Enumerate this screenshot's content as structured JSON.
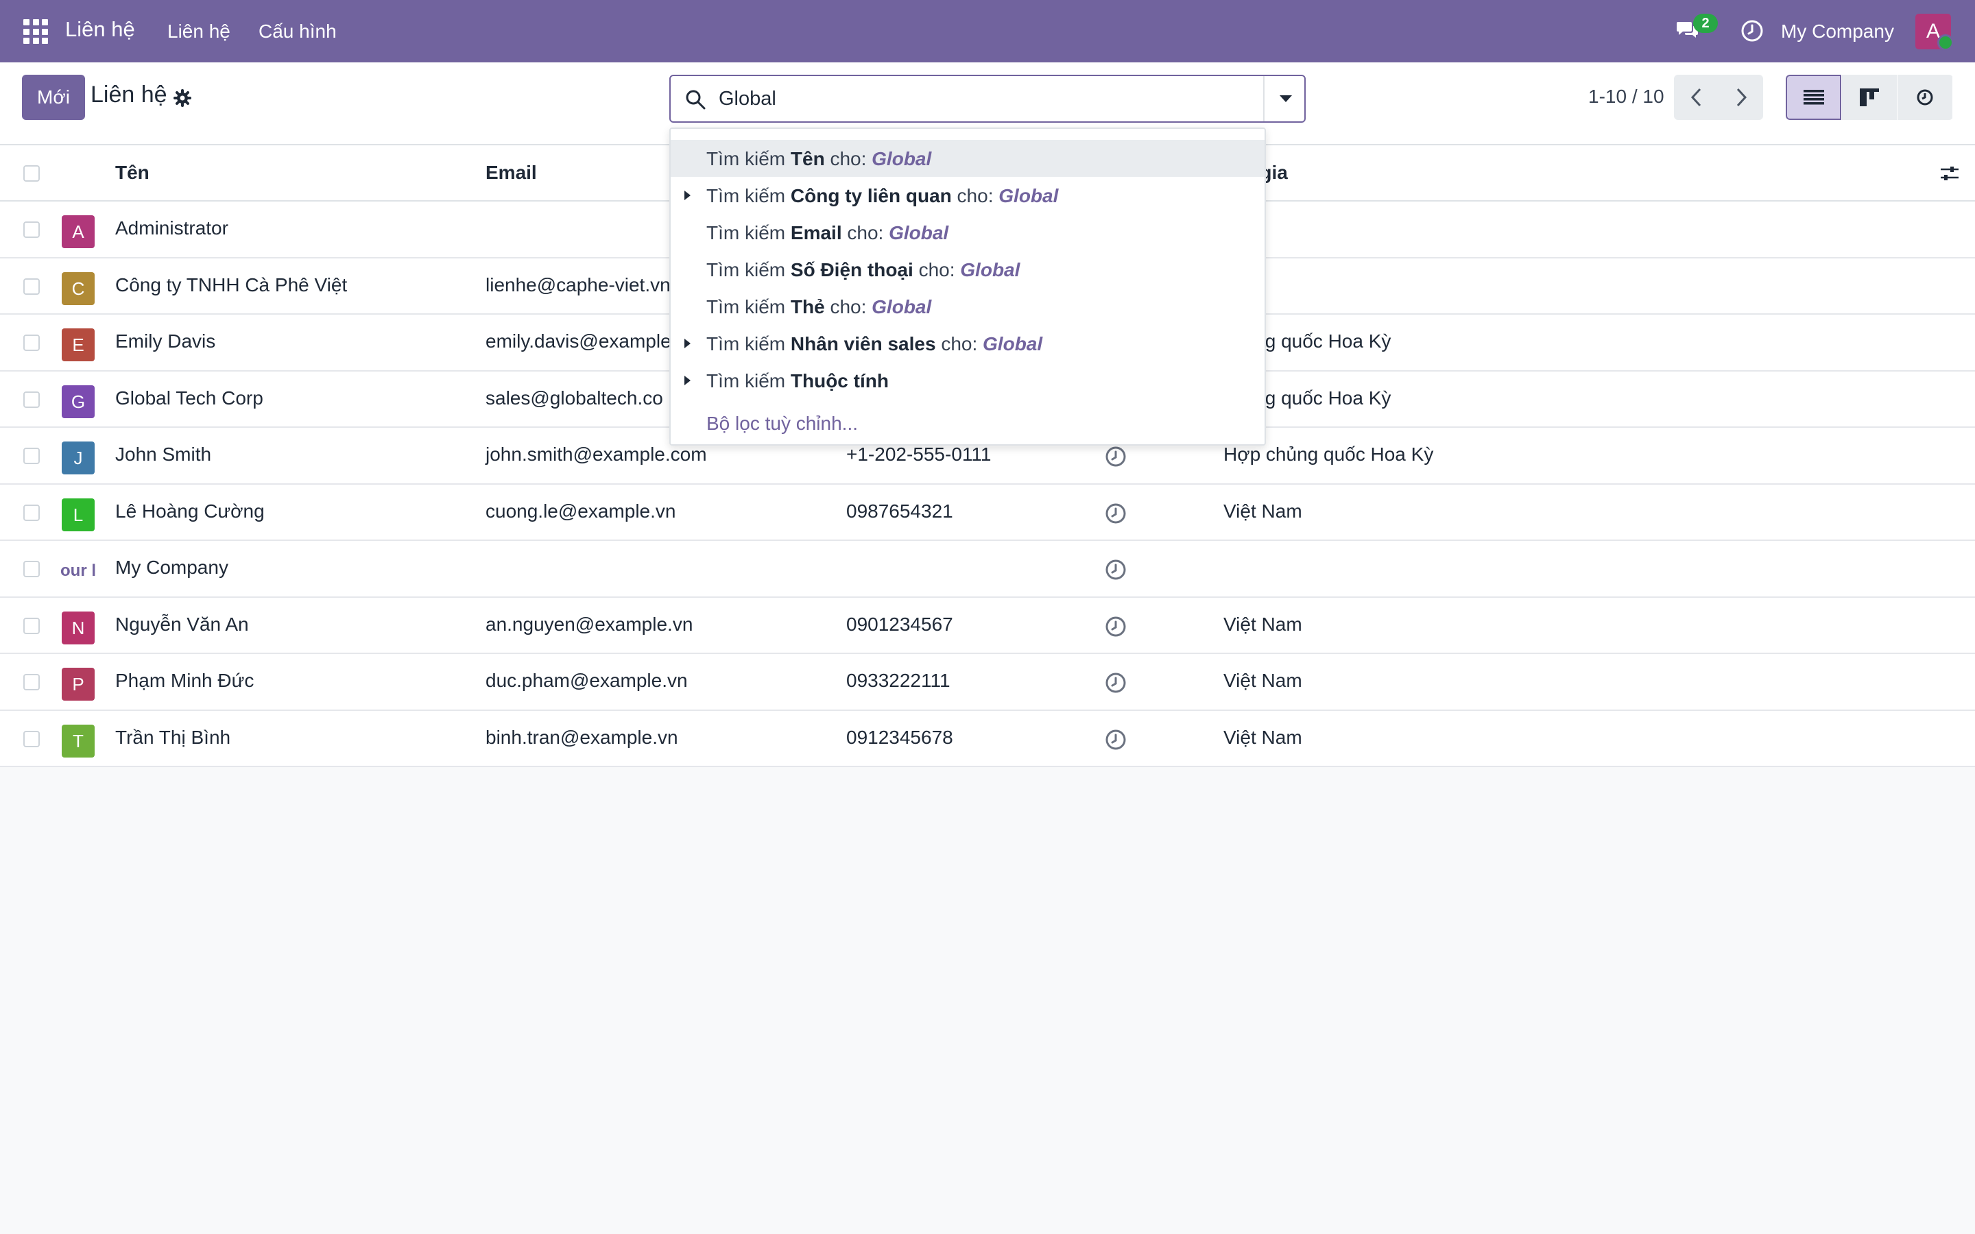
{
  "navbar": {
    "app_name": "Liên hệ",
    "menu": [
      {
        "label": "Liên hệ"
      },
      {
        "label": "Cấu hình"
      }
    ],
    "messages_badge": "2",
    "company": "My Company",
    "user_avatar_initial": "A",
    "icons": [
      "apps-grid-icon",
      "chat-icon",
      "clock-icon"
    ],
    "colors": {
      "brand": "#71639e",
      "online": "#28a745"
    }
  },
  "control_panel": {
    "new_label": "Mới",
    "title": "Liên hệ",
    "search_value": "Global",
    "pager": "1-10 / 10",
    "active_view": "list"
  },
  "search_dropdown": {
    "items": [
      {
        "prefix": "Tìm kiếm ",
        "field": "Tên",
        "mid": " cho: ",
        "term": "Global",
        "expandable": false,
        "focused": true
      },
      {
        "prefix": "Tìm kiếm ",
        "field": "Công ty liên quan",
        "mid": " cho: ",
        "term": "Global",
        "expandable": true
      },
      {
        "prefix": "Tìm kiếm ",
        "field": "Email",
        "mid": " cho: ",
        "term": "Global",
        "expandable": false
      },
      {
        "prefix": "Tìm kiếm ",
        "field": "Số Điện thoại",
        "mid": " cho: ",
        "term": "Global",
        "expandable": false
      },
      {
        "prefix": "Tìm kiếm ",
        "field": "Thẻ",
        "mid": " cho: ",
        "term": "Global",
        "expandable": false
      },
      {
        "prefix": "Tìm kiếm ",
        "field": "Nhân viên sales",
        "mid": " cho: ",
        "term": "Global",
        "expandable": true
      },
      {
        "prefix": "Tìm kiếm ",
        "field": "Thuộc tính",
        "mid": "",
        "term": "",
        "expandable": true
      }
    ],
    "custom_filter": "Bộ lọc tuỳ chỉnh..."
  },
  "table": {
    "headers": {
      "name": "Tên",
      "email": "Email",
      "country_partial": "c gia"
    },
    "rows": [
      {
        "initial": "A",
        "avatar_color": "#b0377a",
        "name": "Administrator",
        "email": "",
        "phone": "",
        "activity": false,
        "country": ""
      },
      {
        "initial": "C",
        "avatar_color": "#b08a35",
        "name": "Công ty TNHH Cà Phê Việt",
        "email": "lienhe@caphe-viet.vn",
        "phone": "",
        "activity": false,
        "country": "Nam"
      },
      {
        "initial": "E",
        "avatar_color": "#b54c3f",
        "name": "Emily Davis",
        "email": "emily.davis@example",
        "phone": "",
        "activity": false,
        "country": "chủng quốc Hoa Kỳ"
      },
      {
        "initial": "G",
        "avatar_color": "#7b4bb0",
        "name": "Global Tech Corp",
        "email": "sales@globaltech.co",
        "phone": "",
        "activity": false,
        "country": "chủng quốc Hoa Kỳ"
      },
      {
        "initial": "J",
        "avatar_color": "#3f7aa8",
        "name": "John Smith",
        "email": "john.smith@example.com",
        "phone": "+1-202-555-0111",
        "activity": true,
        "country": "Hợp chủng quốc Hoa Kỳ"
      },
      {
        "initial": "L",
        "avatar_color": "#2eb82e",
        "name": "Lê Hoàng Cường",
        "email": "cuong.le@example.vn",
        "phone": "0987654321",
        "activity": true,
        "country": "Việt Nam"
      },
      {
        "initial": "our l",
        "avatar_color": "logo",
        "name": "My Company",
        "email": "",
        "phone": "",
        "activity": true,
        "country": ""
      },
      {
        "initial": "N",
        "avatar_color": "#b8336a",
        "name": "Nguyễn Văn An",
        "email": "an.nguyen@example.vn",
        "phone": "0901234567",
        "activity": true,
        "country": "Việt Nam"
      },
      {
        "initial": "P",
        "avatar_color": "#b23c5e",
        "name": "Phạm Minh Đức",
        "email": "duc.pham@example.vn",
        "phone": "0933222111",
        "activity": true,
        "country": "Việt Nam"
      },
      {
        "initial": "T",
        "avatar_color": "#6fb03a",
        "name": "Trần Thị Bình",
        "email": "binh.tran@example.vn",
        "phone": "0912345678",
        "activity": true,
        "country": "Việt Nam"
      }
    ]
  }
}
